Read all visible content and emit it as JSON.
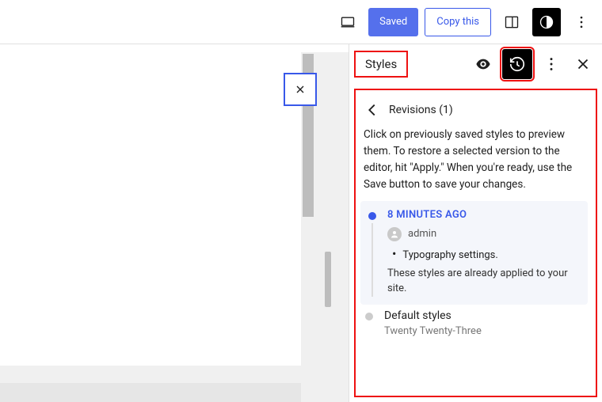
{
  "topbar": {
    "saved_label": "Saved",
    "copy_label": "Copy this"
  },
  "panel": {
    "title": "Styles",
    "revisions": {
      "heading": "Revisions (1)",
      "description": "Click on previously saved styles to preview them. To restore a selected version to the editor, hit \"Apply.\" When you're ready, use the Save button to save your changes.",
      "items": [
        {
          "time": "8 MINUTES AGO",
          "author": "admin",
          "change": "Typography settings.",
          "note": "These styles are already applied to your site."
        }
      ],
      "default": {
        "title": "Default styles",
        "theme": "Twenty Twenty-Three"
      }
    }
  }
}
